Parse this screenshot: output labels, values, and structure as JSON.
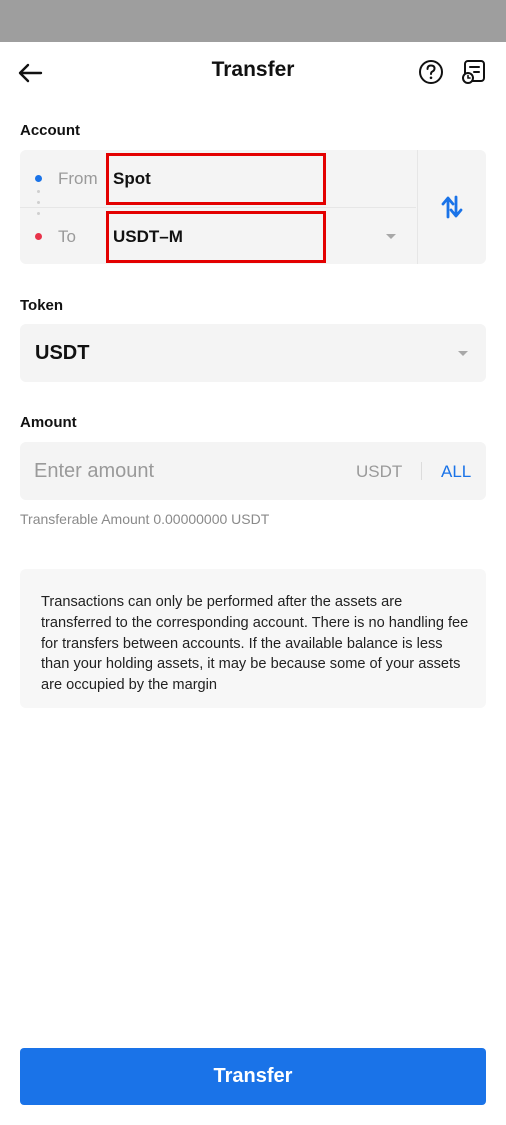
{
  "header": {
    "title": "Transfer",
    "back_icon": "arrow-left-icon",
    "help_icon": "question-circle-icon",
    "records_icon": "transfer-records-icon"
  },
  "account": {
    "section_label": "Account",
    "from_label": "From",
    "from_value": "Spot",
    "to_label": "To",
    "to_value": "USDT–M",
    "swap_icon": "swap-arrows-icon"
  },
  "token": {
    "section_label": "Token",
    "value": "USDT"
  },
  "amount": {
    "section_label": "Amount",
    "placeholder": "Enter amount",
    "unit": "USDT",
    "all_label": "ALL",
    "transferable_text": "Transferable Amount 0.00000000 USDT"
  },
  "notice": {
    "text": "Transactions can only be performed after the assets are transferred to the corresponding account. There is no handling fee for transfers between accounts. If the available balance is less than your holding assets, it may be because some of your assets are occupied by the margin"
  },
  "footer": {
    "transfer_button": "Transfer"
  },
  "colors": {
    "accent": "#1a73e8",
    "from_dot": "#1a73e8",
    "to_dot": "#e8334a",
    "highlight": "#e30000"
  }
}
